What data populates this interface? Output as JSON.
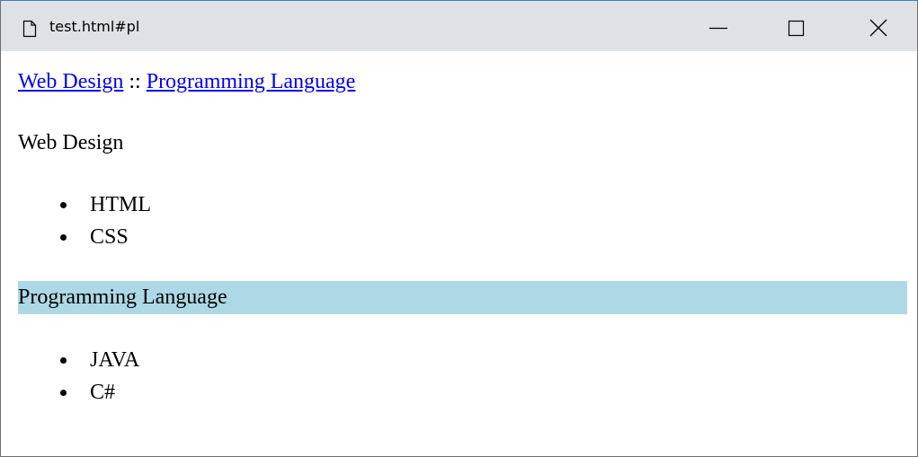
{
  "window": {
    "title": "test.html#pl",
    "controls": {
      "minimize_icon": "minimize-icon",
      "maximize_icon": "maximize-icon",
      "close_icon": "close-icon"
    }
  },
  "nav": {
    "link1": "Web Design",
    "separator": "::",
    "link2": "Programming Language"
  },
  "sections": {
    "web": {
      "title": "Web Design",
      "items": [
        "HTML",
        "CSS"
      ]
    },
    "pl": {
      "title": "Programming Language",
      "highlight_color": "#add8e6",
      "items": [
        "JAVA",
        "C#"
      ]
    }
  },
  "colors": {
    "link": "#0000ee",
    "titlebar": "#dee1e6"
  }
}
